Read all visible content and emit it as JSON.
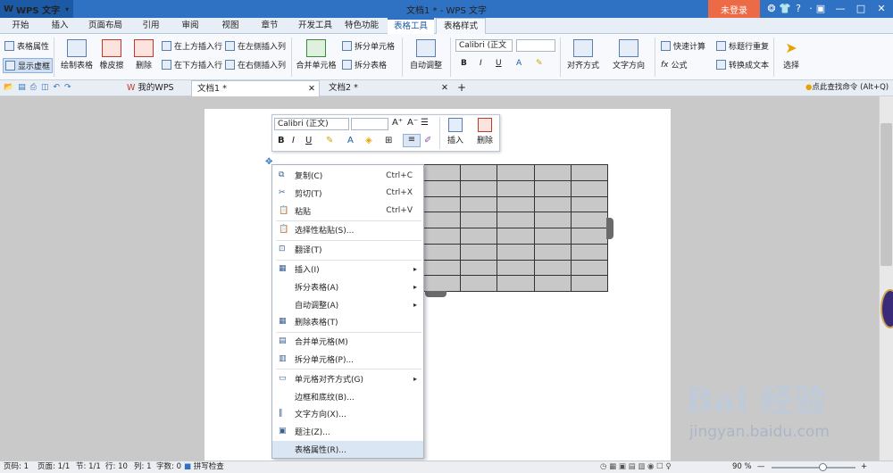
{
  "app": {
    "name": "WPS 文字",
    "logo_glyph": "W",
    "title": "文档1 * - WPS 文字",
    "login_label": "未登录"
  },
  "title_icons": [
    "shirt-icon",
    "help-icon",
    "minimize-ribbon-icon",
    "window-restore-icon",
    "minimize-icon",
    "maximize-icon",
    "close-icon"
  ],
  "title_glyphs": {
    "skin": "❂",
    "shirt": "👕",
    "help": "?",
    "ribbon": "·",
    "restore": "▣",
    "min": "—",
    "max": "□",
    "close": "✕"
  },
  "menu_tabs": [
    "开始",
    "插入",
    "页面布局",
    "引用",
    "审阅",
    "视图",
    "章节",
    "开发工具",
    "特色功能",
    "表格工具",
    "表格样式"
  ],
  "ribbon": {
    "table_props": "表格属性",
    "show_gridlines": "显示虚框",
    "draw_table": "绘制表格",
    "eraser": "橡皮擦",
    "delete": "删除",
    "insert_above": "在上方插入行",
    "insert_below": "在下方插入行",
    "insert_left": "在左侧插入列",
    "insert_right": "在右侧插入列",
    "merge_cells": "合并单元格",
    "split_cells": "拆分单元格",
    "split_table": "拆分表格",
    "auto_fit": "自动调整",
    "font_name": "Calibri (正文",
    "font_size": "",
    "align": "对齐方式",
    "text_direction": "文字方向",
    "quick_calc": "快速计算",
    "formula": "公式",
    "title_repeat": "标题行重复",
    "convert_text": "转换成文本",
    "select": "选择",
    "bold": "B",
    "italic": "I",
    "underline": "U",
    "font_color": "A"
  },
  "doc_tabs": {
    "mywps": "我的WPS",
    "doc1": "文档1 *",
    "doc2": "文档2 *",
    "add": "+",
    "search_cmd": "点此查找命令 (Alt+Q)"
  },
  "float_toolbar": {
    "font": "Calibri (正文)",
    "size": "",
    "bold": "B",
    "italic": "I",
    "underline": "U",
    "font_color": "A",
    "insert": "插入",
    "delete": "删除"
  },
  "context_menu": [
    {
      "label": "复制(C)",
      "shortcut": "Ctrl+C",
      "icon": "copy-icon"
    },
    {
      "label": "剪切(T)",
      "shortcut": "Ctrl+X",
      "icon": "scissors-icon"
    },
    {
      "label": "粘贴",
      "shortcut": "Ctrl+V",
      "icon": "paste-icon"
    },
    {
      "label": "选择性粘贴(S)...",
      "icon": "paste-special-icon"
    },
    {
      "label": "翻译(T)",
      "icon": "translate-icon"
    },
    {
      "label": "插入(I)",
      "icon": "insert-table-icon",
      "submenu": true
    },
    {
      "label": "拆分表格(A)",
      "submenu": true
    },
    {
      "label": "自动调整(A)",
      "submenu": true
    },
    {
      "label": "删除表格(T)",
      "icon": "delete-table-icon"
    },
    {
      "label": "合并单元格(M)",
      "icon": "merge-cells-icon"
    },
    {
      "label": "拆分单元格(P)...",
      "icon": "split-cells-icon"
    },
    {
      "label": "单元格对齐方式(G)",
      "icon": "cell-align-icon",
      "submenu": true
    },
    {
      "label": "边框和底纹(B)..."
    },
    {
      "label": "文字方向(X)...",
      "icon": "text-direction-icon"
    },
    {
      "label": "题注(Z)...",
      "icon": "caption-icon"
    },
    {
      "label": "表格属性(R)...",
      "highlighted": true
    }
  ],
  "table": {
    "rows": 8,
    "cols": 5,
    "fill": "#c8c8c8"
  },
  "status_bar": {
    "page_num": "页码: 1",
    "pages": "页面: 1/1",
    "section": "节: 1/1",
    "row": "行: 10",
    "col": "列: 1",
    "words": "字数: 0",
    "spell": "拼写检查",
    "zoom": "90 %",
    "zoom_minus": "—",
    "zoom_plus": "+",
    "zoom_level": 0.62
  },
  "watermark": {
    "brand": "Bai  经验",
    "url": "jingyan.baidu.com"
  },
  "colors": {
    "title_bar": "#2f72c3",
    "login": "#ec6a45",
    "menu_highlight": "#dbe6f4",
    "table_cell": "#c8c8c8"
  }
}
